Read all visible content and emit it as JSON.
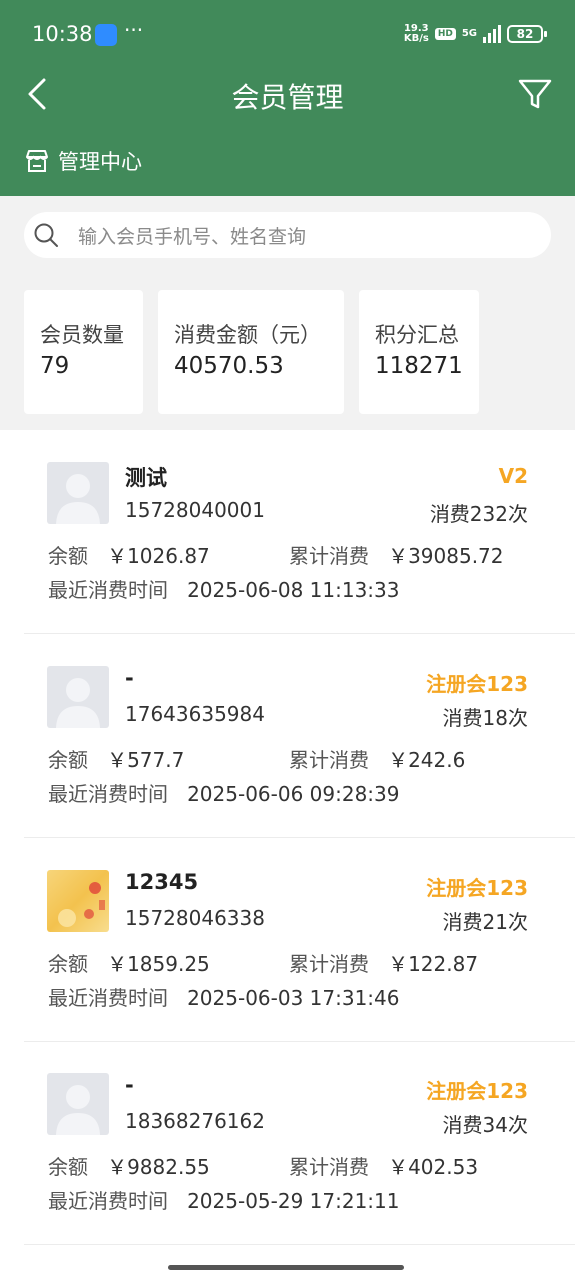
{
  "status": {
    "time": "10:38",
    "dots": "···",
    "net_speed_top": "19.3",
    "net_speed_bottom": "KB/s",
    "hd": "HD",
    "signal_label": "5G",
    "battery": "82"
  },
  "nav": {
    "title": "会员管理",
    "back_icon": "chevron-left-icon",
    "filter_icon": "filter-icon"
  },
  "manage_center": {
    "icon": "store-icon",
    "label": "管理中心"
  },
  "search": {
    "placeholder": "输入会员手机号、姓名查询"
  },
  "stats": [
    {
      "label": "会员数量",
      "value": "79"
    },
    {
      "label": "消费金额（元）",
      "value": "40570.53"
    },
    {
      "label": "积分汇总",
      "value": "118271"
    }
  ],
  "labels": {
    "balance": "余额",
    "total_spent": "累计消费",
    "last_time": "最近消费时间"
  },
  "members": [
    {
      "name": "测试",
      "level": "V2",
      "phone": "15728040001",
      "count": "消费232次",
      "balance": "￥1026.87",
      "total": "￥39085.72",
      "last_time": "2025-06-08 11:13:33"
    },
    {
      "name": "-",
      "level": "注册会123",
      "phone": "17643635984",
      "count": "消费18次",
      "balance": "￥577.7",
      "total": "￥242.6",
      "last_time": "2025-06-06 09:28:39"
    },
    {
      "name": "12345",
      "level": "注册会123",
      "phone": "15728046338",
      "count": "消费21次",
      "balance": "￥1859.25",
      "total": "￥122.87",
      "last_time": "2025-06-03 17:31:46"
    },
    {
      "name": "-",
      "level": "注册会123",
      "phone": "18368276162",
      "count": "消费34次",
      "balance": "￥9882.55",
      "total": "￥402.53",
      "last_time": "2025-05-29 17:21:11"
    }
  ],
  "colors": {
    "header": "#418a5a",
    "level": "#f5a623",
    "background_gray": "#f2f2f2"
  }
}
